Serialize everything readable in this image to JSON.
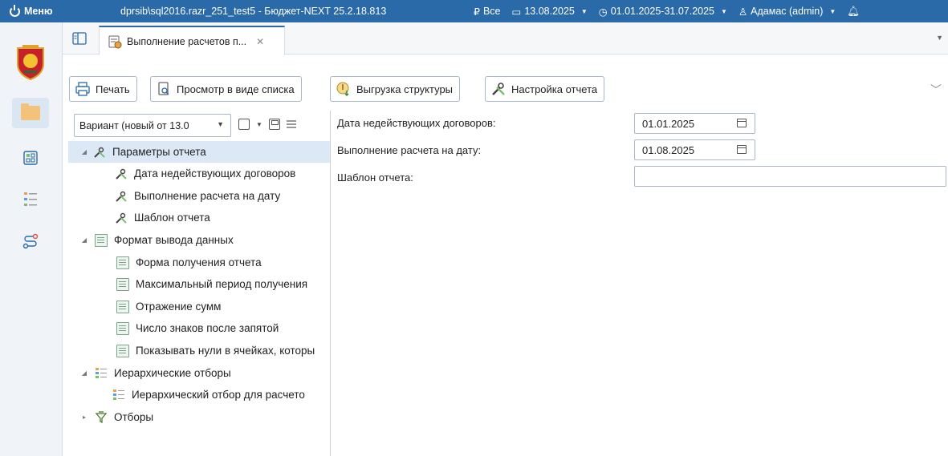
{
  "topbar": {
    "menu_label": "Меню",
    "app_title": "dprsib\\sql2016.razr_251_test5 - Бюджет-NEXT 25.2.18.813",
    "scope_label": "Все",
    "date_label": "13.08.2025",
    "period_label": "01.01.2025-31.07.2025",
    "user_label": "Адамас (admin)"
  },
  "tab": {
    "title": "Выполнение расчетов п...",
    "close_glyph": "✕"
  },
  "toolbar": {
    "print_label": "Печать",
    "list_view_label": "Просмотр в виде списка",
    "export_structure_label": "Выгрузка структуры",
    "report_settings_label": "Настройка отчета"
  },
  "variant": {
    "selected": "Вариант (новый от 13.0"
  },
  "tree": {
    "params": {
      "label": "Параметры отчета",
      "children": [
        "Дата недействующих договоров",
        "Выполнение расчета на дату",
        "Шаблон отчета"
      ]
    },
    "format": {
      "label": "Формат вывода данных",
      "children": [
        "Форма получения отчета",
        "Максимальный период получения",
        "Отражение сумм",
        "Число знаков после запятой",
        "Показывать нули в ячейках, которы"
      ]
    },
    "hier": {
      "label": "Иерархические отборы",
      "children": [
        "Иерархический отбор для расчето"
      ]
    },
    "filters": {
      "label": "Отборы"
    }
  },
  "form": {
    "inactive_contracts_label": "Дата недействующих договоров:",
    "inactive_contracts_value": "01.01.2025",
    "calc_date_label": "Выполнение расчета на дату:",
    "calc_date_value": "01.08.2025",
    "template_label": "Шаблон отчета:",
    "template_value": ""
  },
  "colors": {
    "topbar": "#2b6aa8",
    "selection": "#dce8f6",
    "rail": "#f0f3f7"
  }
}
